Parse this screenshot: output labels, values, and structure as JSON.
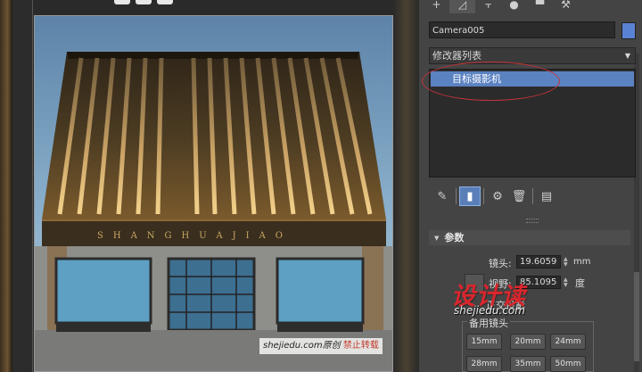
{
  "viewport": {
    "sign_text": "SHANGHUAJIAO",
    "watermark_site": "shejiedu.com原创",
    "watermark_warning": "禁止转载"
  },
  "panel": {
    "tabs": [
      {
        "icon": "create-icon",
        "glyph": "+"
      },
      {
        "icon": "modify-icon",
        "glyph": "◿"
      },
      {
        "icon": "hierarchy-icon",
        "glyph": "⫟"
      },
      {
        "icon": "motion-icon",
        "glyph": "●"
      },
      {
        "icon": "display-icon",
        "glyph": "▀"
      },
      {
        "icon": "utilities-icon",
        "glyph": "⚒"
      }
    ],
    "object_name": "Camera005",
    "object_color": "#5a82d4",
    "modifier_list": "修改器列表",
    "stack_item": "目标摄影机",
    "parameters_title": "参数",
    "lens_label": "镜头:",
    "lens_value": "19.6059",
    "lens_unit": "mm",
    "fov_label": "视野:",
    "fov_value": "85.1095",
    "fov_unit": "度",
    "ortho_label": "正交投影",
    "stock_lenses_label": "备用镜头",
    "stock_lenses": [
      "15mm",
      "20mm",
      "24mm",
      "28mm",
      "35mm",
      "50mm"
    ]
  },
  "watermark": {
    "logo_text": "设计读",
    "logo_url": "shejiedu.com"
  },
  "colors": {
    "selection_blue": "#5b82c1",
    "annotation_red": "#c4343a",
    "panel_bg": "#444444"
  }
}
